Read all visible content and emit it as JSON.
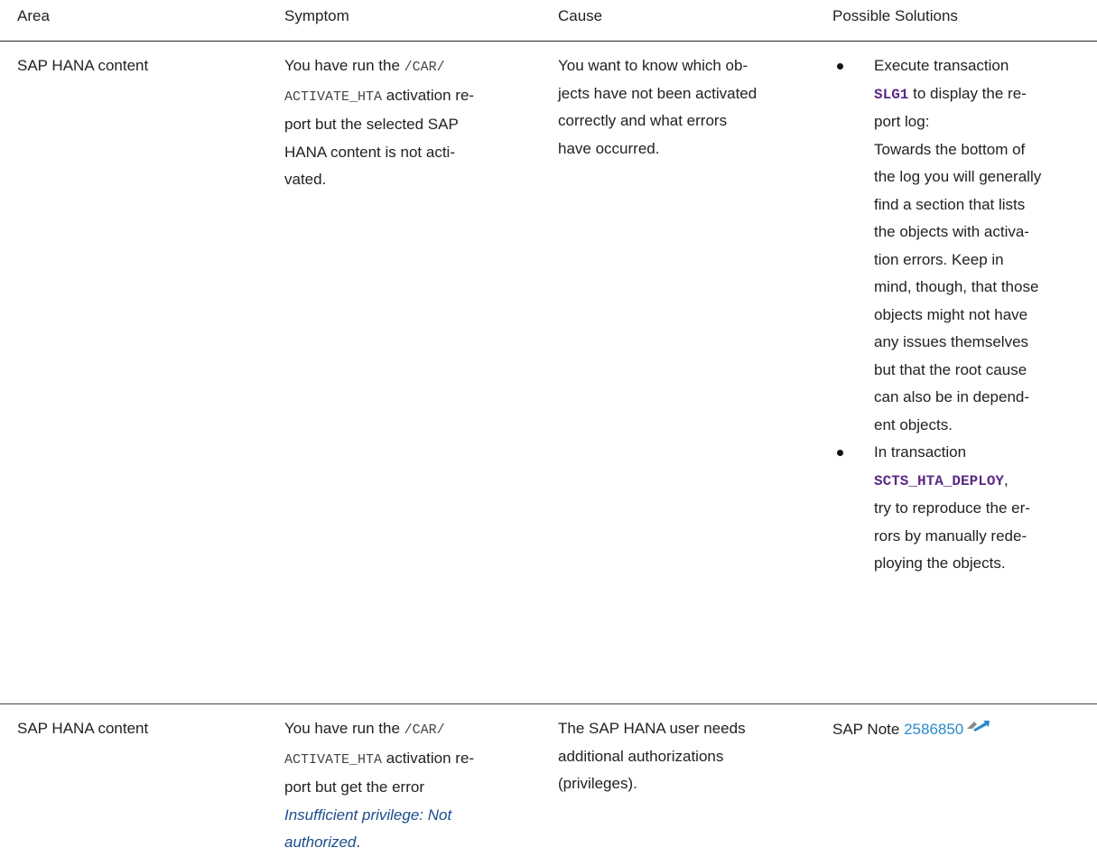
{
  "headers": [
    "Area",
    "Symptom",
    "Cause",
    "Possible Solutions"
  ],
  "row1": {
    "area": "SAP HANA content",
    "symptom_pre": "You have run the ",
    "symptom_code_a": "/CAR/",
    "symptom_code_b": "ACTIVATE_HTA",
    "symptom_post_1": " activation re-",
    "symptom_post_2": "port but the selected SAP",
    "symptom_post_3": "HANA content is not acti-",
    "symptom_post_4": "vated.",
    "cause_1": "You want to know which ob-",
    "cause_2": "jects have not been activated",
    "cause_3": "correctly and what errors",
    "cause_4": "have occurred.",
    "sol1_pre": "Execute transaction",
    "sol1_tx": "SLG1",
    "sol1_post_a": " to display the re-",
    "sol1_lines": [
      "port log:",
      "Towards the bottom of",
      "the log you will generally",
      "find a section that lists",
      "the objects with activa-",
      "tion errors. Keep in",
      "mind, though, that those",
      "objects might not have",
      "any issues themselves",
      "but that the root cause",
      "can also be in depend-",
      "ent objects."
    ],
    "sol2_pre": "In transaction",
    "sol2_tx": "SCTS_HTA_DEPLOY",
    "sol2_comma": ",",
    "sol2_lines": [
      "try to reproduce the er-",
      "rors by manually rede-",
      "ploying the objects."
    ]
  },
  "row2": {
    "area": "SAP HANA content",
    "symptom_pre": "You have run the ",
    "symptom_code_a": "/CAR/",
    "symptom_code_b": "ACTIVATE_HTA",
    "symptom_post_1": " activation re-",
    "symptom_post_2": "port but get the error",
    "symptom_em_1": "Insufficient privilege: Not",
    "symptom_em_2": "authorized",
    "symptom_end": ".",
    "cause_1": "The SAP HANA user needs",
    "cause_2": "additional authorizations",
    "cause_3": "(privileges).",
    "sol_pre": "SAP Note ",
    "sol_link": "2586850"
  }
}
